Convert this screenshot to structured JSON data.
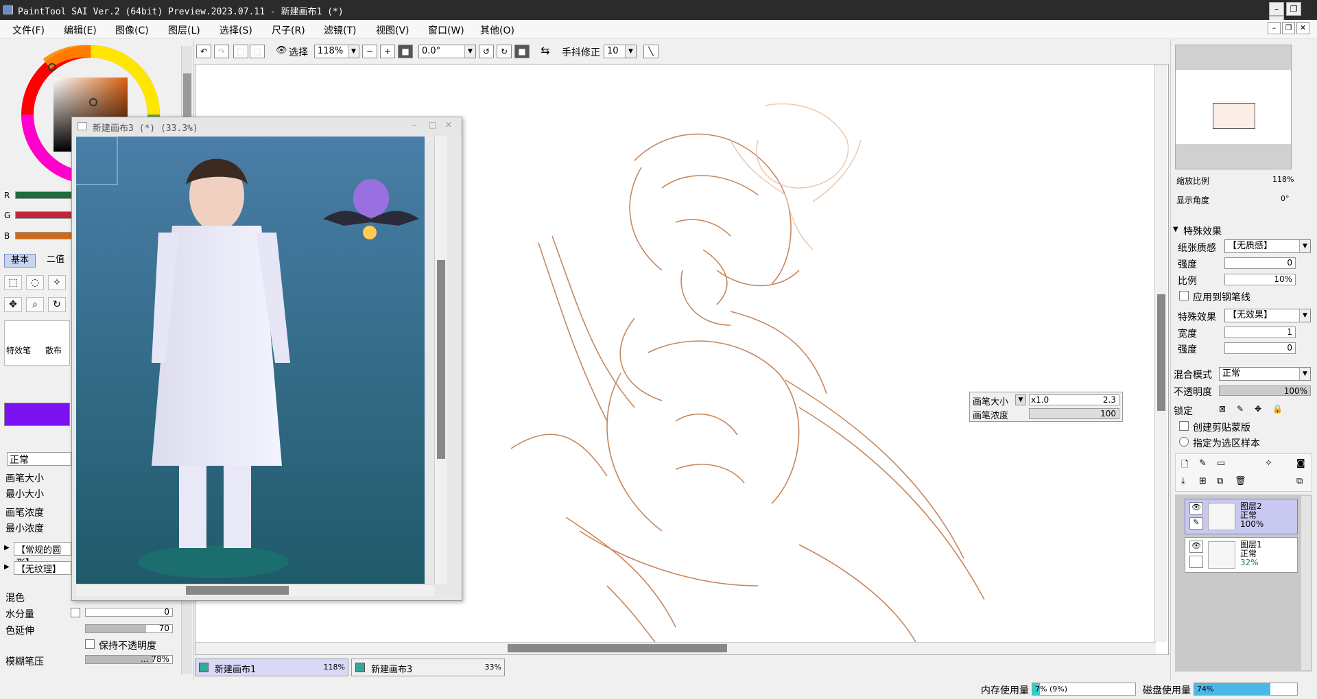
{
  "window": {
    "title": "PaintTool SAI Ver.2 (64bit) Preview.2023.07.11 - 新建画布1 (*)"
  },
  "menu": [
    "文件(F)",
    "编辑(E)",
    "图像(C)",
    "图层(L)",
    "选择(S)",
    "尺子(R)",
    "滤镜(T)",
    "视图(V)",
    "窗口(W)",
    "其他(O)"
  ],
  "left": {
    "rgb": [
      "R",
      "G",
      "B"
    ],
    "tabs": {
      "basic": "基本",
      "second": "二值"
    },
    "brush_cells": [
      "特效笔",
      "散布"
    ],
    "blend_mode": "正常",
    "labels": {
      "brush_size": "画笔大小",
      "min_size": "最小大小",
      "density": "画笔浓度",
      "min_density": "最小浓度"
    },
    "shape": "【常规的圆形】",
    "texture": "【无纹理】",
    "mix": "混色",
    "water": "水分量",
    "water_val": "0",
    "color_stretch": "色延伸",
    "color_stretch_val": "70",
    "keep_opacity": "保持不透明度",
    "blur_pressure": "模糊笔压",
    "blur_pressure_val": "...  78%"
  },
  "toolbar": {
    "select_label": "选择",
    "zoom": "118%",
    "angle": "0.0°",
    "stabilizer_label": "手抖修正",
    "stabilizer_val": "10"
  },
  "float_window": {
    "title": "新建画布3 (*) (33.3%)"
  },
  "brush_popup": {
    "size_label": "画笔大小",
    "size_mult": "x1.0",
    "size_val": "2.3",
    "density_label": "画笔浓度",
    "density_val": "100"
  },
  "tabs": [
    {
      "name": "新建画布1",
      "pct": "118%"
    },
    {
      "name": "新建画布3",
      "pct": "33%"
    }
  ],
  "right": {
    "zoom_label": "缩放比例",
    "zoom_val": "118%",
    "angle_label": "显示角度",
    "angle_val": "0°",
    "effects_header": "特殊效果",
    "paper_label": "纸张质感",
    "paper_val": "【无质感】",
    "strength_label": "强度",
    "strength_val": "0",
    "ratio_label": "比例",
    "ratio_val": "10%",
    "apply_pen": "应用到钢笔线",
    "effect_label": "特殊效果",
    "effect_val": "【无效果】",
    "width_label": "宽度",
    "width_val": "1",
    "strength2_label": "强度",
    "strength2_val": "0",
    "blend_label": "混合模式",
    "blend_val": "正常",
    "opacity_label": "不透明度",
    "opacity_val": "100%",
    "lock_label": "锁定",
    "clip": "创建剪贴蒙版",
    "sample": "指定为选区样本",
    "layers": [
      {
        "name": "图层2",
        "mode": "正常",
        "opacity": "100%"
      },
      {
        "name": "图层1",
        "mode": "正常",
        "opacity": "32%"
      }
    ]
  },
  "status": {
    "mem_label": "内存使用量",
    "mem_val": "7%  (9%)",
    "disk_label": "磁盘使用量",
    "disk_val": "74%"
  }
}
